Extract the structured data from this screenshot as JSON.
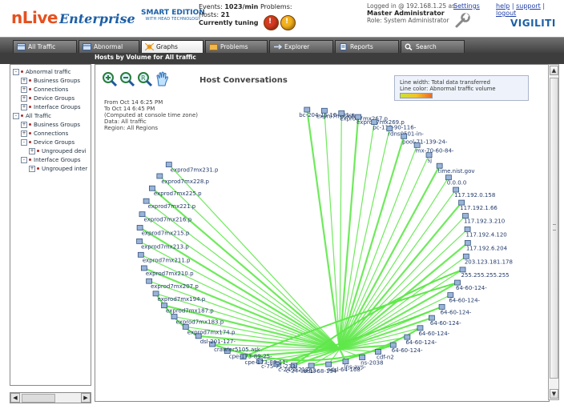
{
  "brand": {
    "logo_n": "nLive",
    "logo_enterprise": "Enterprise",
    "edition_main": "SMART EDITION",
    "edition_sub": "WITH HEAD TECHNOLOGY",
    "company": "VIGILITI",
    "colors": {
      "orange": "#e6501e",
      "blue": "#1c5fa6"
    }
  },
  "status": {
    "events_label": "Events:",
    "events_value": "1023/min",
    "hosts_label": "Hosts:",
    "hosts_value": "21",
    "tuning": "Currently tuning",
    "problems_label": "Problems:"
  },
  "login": {
    "logged_in": "Logged in @ 192.168.1.25 as:",
    "user": "Master Administrator",
    "role": "Role: System Administrator"
  },
  "links": {
    "settings": "Settings",
    "help": "help",
    "support": "support",
    "logout": "logout",
    "separator": "|"
  },
  "tabs": [
    {
      "label": "All Traffic",
      "icon": "table-icon"
    },
    {
      "label": "Abnormal Traffic",
      "icon": "table-icon"
    },
    {
      "label": "Graphs",
      "icon": "graph-icon",
      "active": true
    },
    {
      "label": "Problems",
      "icon": "problems-icon"
    },
    {
      "label": "Explorer",
      "icon": "explorer-icon"
    },
    {
      "label": "Reports",
      "icon": "reports-icon"
    },
    {
      "label": "Search",
      "icon": "search-icon"
    }
  ],
  "subheader": "Hosts by Volume for All traffic",
  "tree": [
    {
      "label": "Abnormal traffic",
      "level": 0,
      "toggle": "-"
    },
    {
      "label": "Business Groups",
      "level": 1,
      "toggle": "+"
    },
    {
      "label": "Connections",
      "level": 1,
      "toggle": "+"
    },
    {
      "label": "Device Groups",
      "level": 1,
      "toggle": "+"
    },
    {
      "label": "Interface Groups",
      "level": 1,
      "toggle": "+"
    },
    {
      "label": "All Traffic",
      "level": 0,
      "toggle": "-"
    },
    {
      "label": "Business Groups",
      "level": 1,
      "toggle": "+"
    },
    {
      "label": "Connections",
      "level": 1,
      "toggle": "+"
    },
    {
      "label": "Device Groups",
      "level": 1,
      "toggle": "-"
    },
    {
      "label": "Ungrouped devi",
      "level": 2,
      "toggle": "+"
    },
    {
      "label": "Interface Groups",
      "level": 1,
      "toggle": "-"
    },
    {
      "label": "Ungrouped inter",
      "level": 2,
      "toggle": "+"
    }
  ],
  "graph": {
    "title": "Host Conversations",
    "from": "From Oct 14 6:25 PM",
    "to": "To Oct 14 6:45 PM",
    "computed": "(Computed at console time zone)",
    "data": "Data: All traffic",
    "region": "Region: All Regions",
    "legend_line1": "Line width: Total data transferred",
    "legend_line2": "Line color: Abnormal traffic volume",
    "line_color": "#5fe84a",
    "nodes": [
      "bc-204-15-10-161.p",
      "expro7mx265.p",
      "exprod7mx267.p",
      "exprod7mx269.p",
      "pc-118-90-116-",
      "rdns0501-in-",
      "pool-71-139-24-",
      "mx-70-60-84-",
      "sj",
      "time.nist.gov",
      "0.0.0.0",
      "117.192.0.158",
      "117.192.1.66",
      "117.192.3.210",
      "117.192.4.120",
      "117.192.6.204",
      "203.123.181.178",
      "255.255.255.255",
      "64-60-124-",
      "64-60-124-",
      "64-60-124-",
      "64-60-124-",
      "64-60-124-",
      "64-60-124-",
      "64-60-124-",
      "cdf-n2",
      "ns-2038",
      "lns-ays-",
      "adsl-64-168-",
      "adsl-68-194-",
      "c-24-10-13-",
      "c-24-2-217-",
      "c-75-71-233-",
      "cpe-173-89-11-",
      "cpe-173-89-25-",
      "crawler5105.ask.",
      "dsl-201-127-",
      "exprod7mx174.p",
      "exprod7mx183.p",
      "exprod7mx187.p",
      "exprod7mx194.p",
      "exprod7mx207.p",
      "exprod7mx210.p",
      "exprod7mx211.p",
      "exprod7mx213.p",
      "exprod7mx215.p",
      "exprod7mx216.p",
      "exprod7mx221.p",
      "exprod7mx225.p",
      "exprod7mx228.p",
      "exprod7mx231.p"
    ]
  }
}
